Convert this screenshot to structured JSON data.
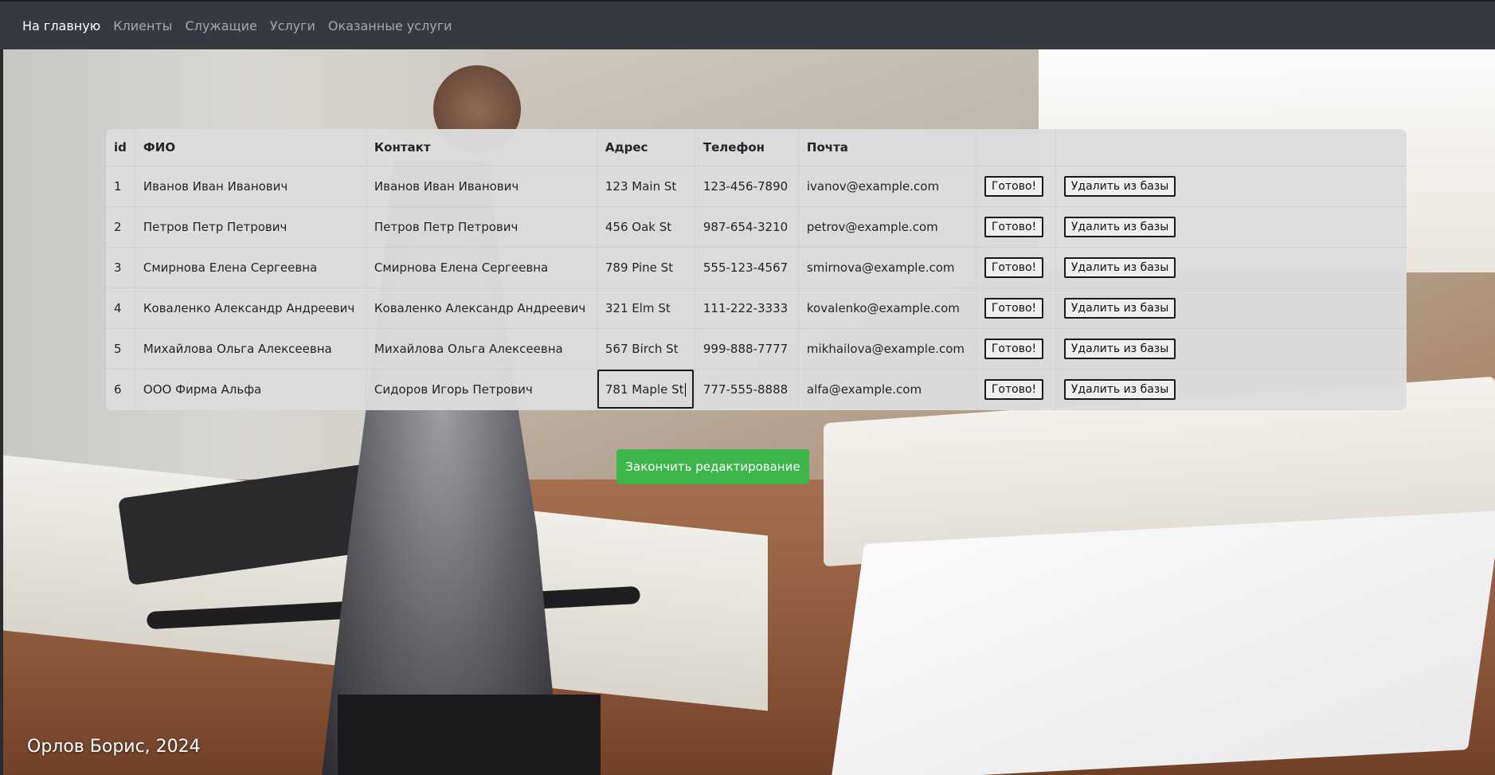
{
  "nav": {
    "items": [
      {
        "label": "На главную",
        "active": true
      },
      {
        "label": "Клиенты",
        "active": false
      },
      {
        "label": "Служащие",
        "active": false
      },
      {
        "label": "Услуги",
        "active": false
      },
      {
        "label": "Оказанные услуги",
        "active": false
      }
    ]
  },
  "table": {
    "headers": [
      "id",
      "ФИО",
      "Контакт",
      "Адрес",
      "Телефон",
      "Почта",
      "",
      ""
    ],
    "rows": [
      {
        "id": "1",
        "fio": "Иванов Иван Иванович",
        "contact": "Иванов Иван Иванович",
        "address": "123 Main St",
        "phone": "123-456-7890",
        "email": "ivanov@example.com"
      },
      {
        "id": "2",
        "fio": "Петров Петр Петрович",
        "contact": "Петров Петр Петрович",
        "address": "456 Oak St",
        "phone": "987-654-3210",
        "email": "petrov@example.com"
      },
      {
        "id": "3",
        "fio": "Смирнова Елена Сергеевна",
        "contact": "Смирнова Елена Сергеевна",
        "address": "789 Pine St",
        "phone": "555-123-4567",
        "email": "smirnova@example.com"
      },
      {
        "id": "4",
        "fio": "Коваленко Александр Андреевич",
        "contact": "Коваленко Александр Андреевич",
        "address": "321 Elm St",
        "phone": "111-222-3333",
        "email": "kovalenko@example.com"
      },
      {
        "id": "5",
        "fio": "Михайлова Ольга Алексеевна",
        "contact": "Михайлова Ольга Алексеевна",
        "address": "567 Birch St",
        "phone": "999-888-7777",
        "email": "mikhailova@example.com"
      },
      {
        "id": "6",
        "fio": "ООО Фирма Альфа",
        "contact": "Сидоров Игорь Петрович",
        "address": "781 Maple St",
        "phone": "777-555-8888",
        "email": "alfa@example.com"
      }
    ],
    "ready_label": "Готово!",
    "delete_label": "Удалить из базы"
  },
  "finish_button": "Закончить редактирование",
  "footer": "Орлов Борис, 2024",
  "colors": {
    "navbar": "#343a40",
    "finish_button": "#3cb54a"
  }
}
